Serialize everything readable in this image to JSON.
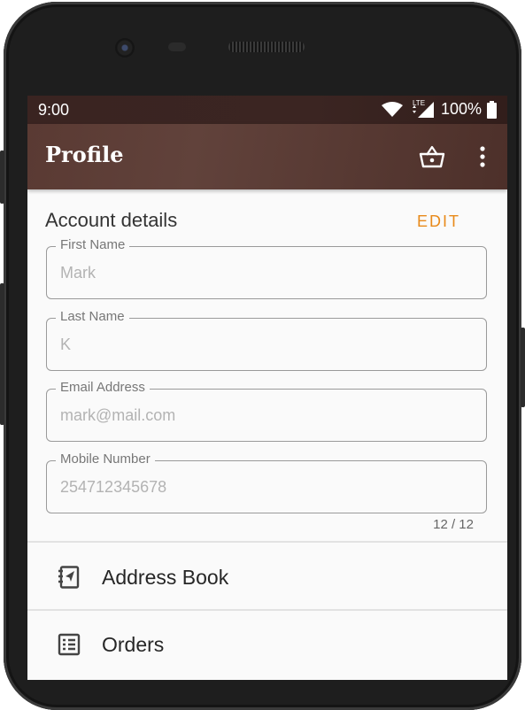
{
  "status_bar": {
    "time": "9:00",
    "network": "LTE",
    "battery": "100%"
  },
  "app_bar": {
    "title": "Profile",
    "icons": [
      "basket-icon",
      "more-vert-icon"
    ]
  },
  "account": {
    "section_title": "Account details",
    "edit_label": "EDIT",
    "fields": [
      {
        "label": "First Name",
        "value": "Mark"
      },
      {
        "label": "Last Name",
        "value": "K"
      },
      {
        "label": "Email Address",
        "value": "mark@mail.com"
      },
      {
        "label": "Mobile Number",
        "value": "254712345678"
      }
    ],
    "mobile_counter": "12 / 12"
  },
  "menu": [
    {
      "label": "Address Book",
      "icon": "address-book-icon"
    },
    {
      "label": "Orders",
      "icon": "orders-list-icon"
    }
  ],
  "colors": {
    "appbar": "#5a3a33",
    "statusbar": "#3a2421",
    "accent": "#e88a1a"
  }
}
